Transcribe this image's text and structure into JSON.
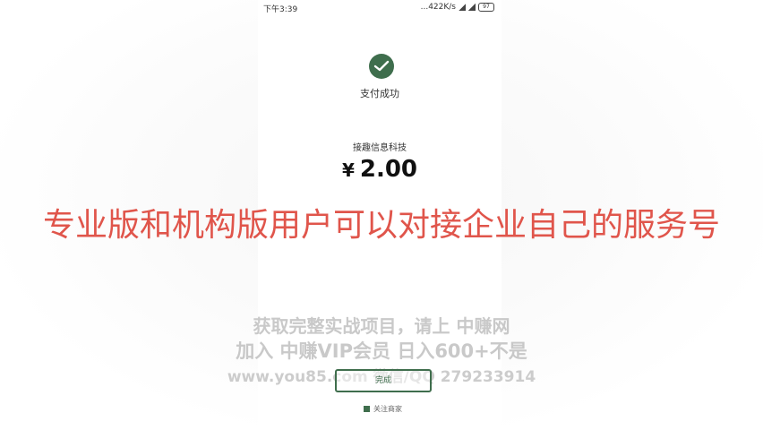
{
  "status_bar": {
    "time": "下午3:39",
    "speed": "...422K/s",
    "battery": "97"
  },
  "payment": {
    "status_text": "支付成功",
    "merchant": "接趣信息科技",
    "currency": "¥",
    "amount": "2.00"
  },
  "caption": "专业版和机构版用户可以对接企业自己的服务号",
  "watermark": {
    "line1": "获取完整实战项目，请上 中赚网",
    "line2": "加入 中赚VIP会员 日入600+不是",
    "line3": "www.you85.com 微信/QQ 279233914"
  },
  "done_button_label": "完成",
  "follow_label": "关注商家",
  "colors": {
    "brand_green": "#3f6e4d",
    "caption_red": "#e0554b"
  }
}
